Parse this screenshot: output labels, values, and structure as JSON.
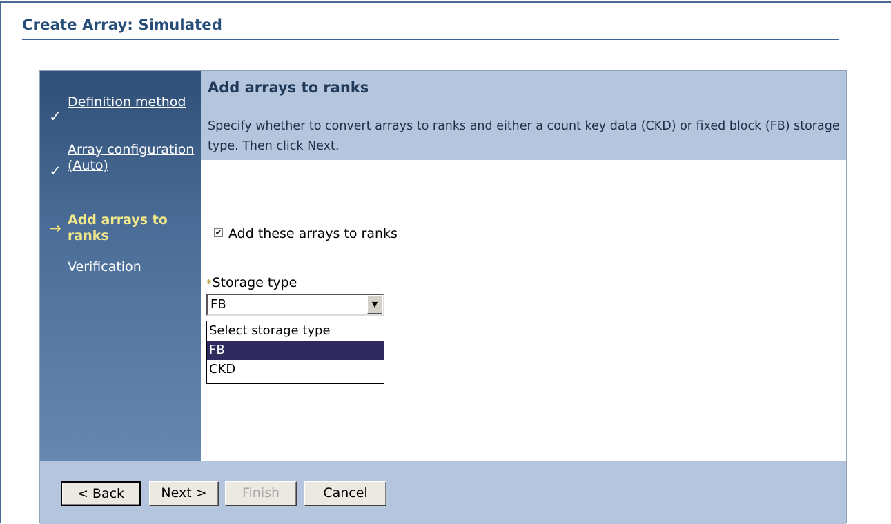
{
  "page": {
    "title": "Create Array: Simulated"
  },
  "steps": [
    {
      "label": "Definition method",
      "state": "completed",
      "mark": "✓"
    },
    {
      "label": "Array configuration (Auto)",
      "state": "completed",
      "mark": "✓"
    },
    {
      "label": "Add arrays to ranks",
      "state": "current",
      "mark": "→"
    },
    {
      "label": "Verification",
      "state": "pending",
      "mark": ""
    }
  ],
  "content": {
    "heading": "Add arrays to ranks",
    "description": "Specify whether to convert arrays to ranks and either a count key data (CKD) or fixed block (FB) storage type. Then click Next.",
    "checkbox_label": "Add these arrays to ranks",
    "checkbox_checked": true,
    "checkbox_glyph": "✔",
    "required_marker": "*",
    "storage_label": "Storage type",
    "storage_value": "FB",
    "dropdown_arrow": "▼",
    "options": [
      "Select storage type",
      "FB",
      "CKD"
    ],
    "highlighted_option": "FB"
  },
  "buttons": {
    "back": "< Back",
    "next": "Next >",
    "finish": "Finish",
    "cancel": "Cancel"
  },
  "colors": {
    "title": "#264c78",
    "header_band": "#b5c5dd",
    "nav_top": "#2f4f77",
    "nav_bottom": "#6787b0",
    "current_step": "#f3e98a",
    "option_highlight": "#2f2b5e"
  }
}
